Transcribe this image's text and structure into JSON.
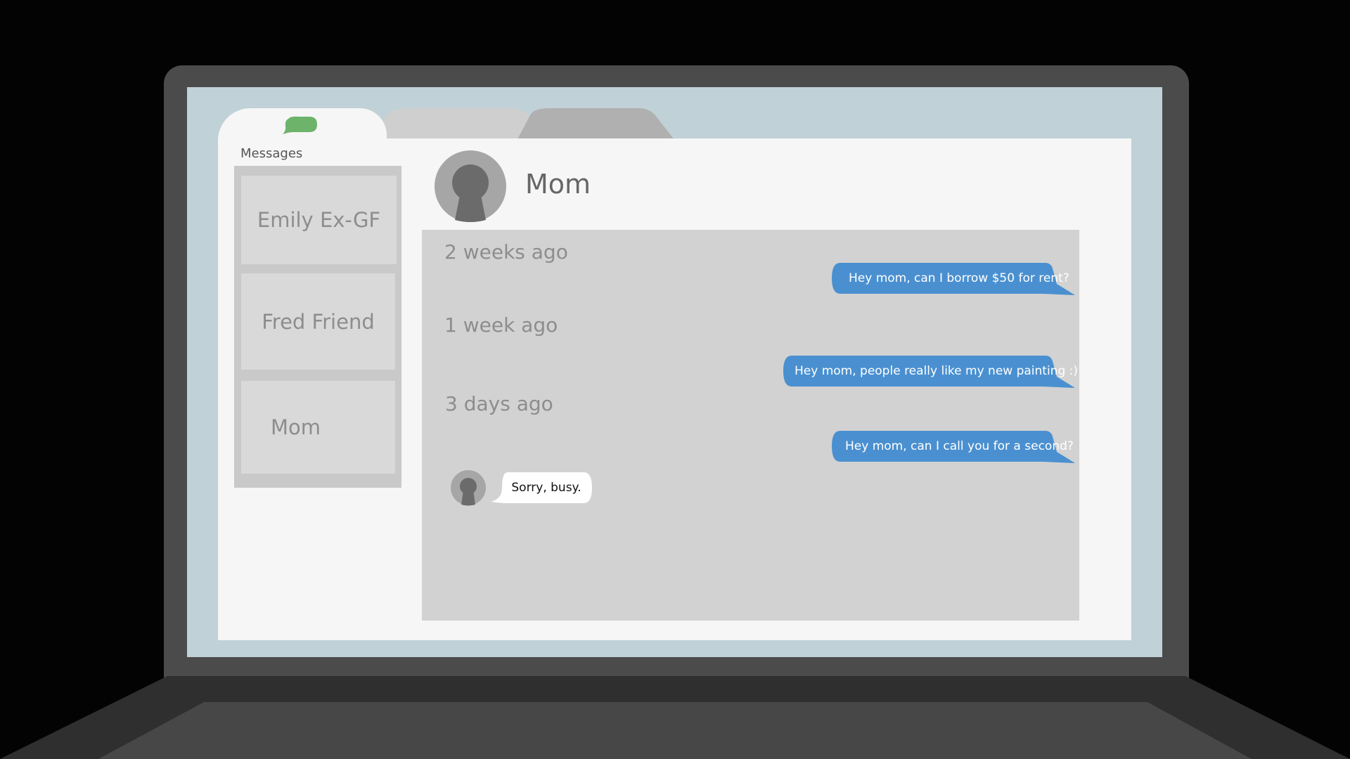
{
  "app": {
    "tab_label": "Messages",
    "icon": "chat-bubble-icon",
    "accent_color": "#6db36a"
  },
  "contacts": [
    {
      "label": "Emily Ex-GF"
    },
    {
      "label": "Fred Friend"
    },
    {
      "label": "Mom"
    }
  ],
  "conversation": {
    "contact_name": "Mom",
    "avatar_icon": "person-silhouette-icon",
    "groups": [
      {
        "time": "2 weeks ago",
        "message": "Hey mom, can I borrow $50 for rent?"
      },
      {
        "time": "1 week ago",
        "message": "Hey mom, people really like my new painting :)"
      },
      {
        "time": "3 days ago",
        "message": "Hey mom, can I call you for a second?"
      }
    ],
    "reply": "Sorry, busy.",
    "outgoing_color": "#4a90d0"
  }
}
